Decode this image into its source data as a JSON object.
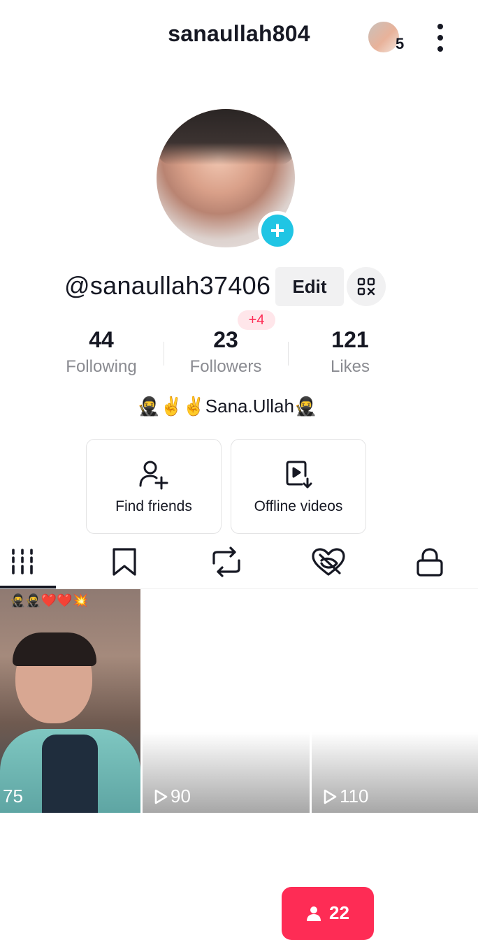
{
  "header": {
    "title": "sanaullah804",
    "account_count": "5"
  },
  "profile": {
    "username": "@sanaullah37406",
    "edit_label": "Edit",
    "bio": "🥷✌️✌️Sana.Ullah🥷"
  },
  "stats": {
    "following": {
      "value": "44",
      "label": "Following"
    },
    "followers": {
      "value": "23",
      "label": "Followers",
      "badge": "+4"
    },
    "likes": {
      "value": "121",
      "label": "Likes"
    }
  },
  "actions": [
    {
      "label": "Find friends",
      "icon": "add-person-icon"
    },
    {
      "label": "Offline videos",
      "icon": "offline-video-icon"
    }
  ],
  "tabs": [
    {
      "name": "videos",
      "icon": "grid-bars-icon",
      "active": true
    },
    {
      "name": "favorites",
      "icon": "bookmark-icon"
    },
    {
      "name": "reposts",
      "icon": "repost-icon"
    },
    {
      "name": "liked",
      "icon": "hidden-heart-icon"
    },
    {
      "name": "private",
      "icon": "lock-icon"
    }
  ],
  "videos": [
    {
      "views": "75",
      "overlay_emojis": "🥷🥷❤️❤️💥"
    },
    {
      "views": "90"
    },
    {
      "views": "110"
    }
  ],
  "friends_pill": {
    "count": "22"
  },
  "colors": {
    "accent": "#fe2c55",
    "add_badge": "#20c5e4"
  }
}
